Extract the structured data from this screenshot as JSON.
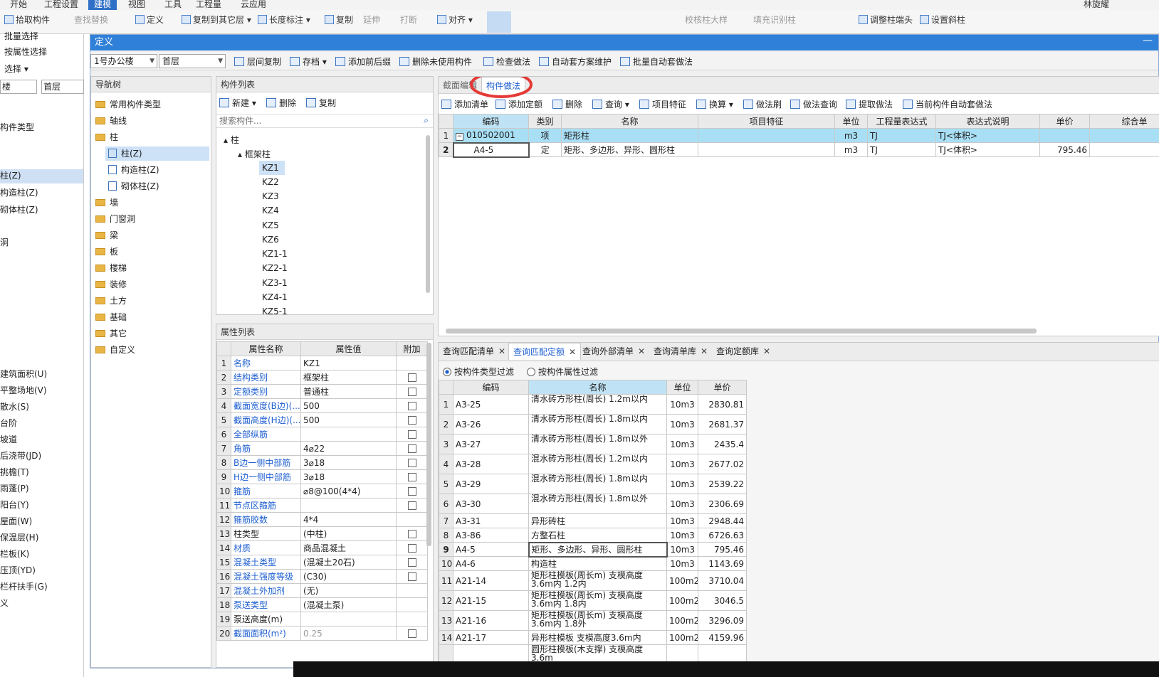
{
  "menubar": {
    "items": [
      "开始",
      "工程设置",
      "建模",
      "视图",
      "工具",
      "工程量",
      "云应用"
    ],
    "active": 2,
    "user": "林旋耀"
  },
  "ribbon": {
    "group1": [
      "拾取构件",
      "批量选择",
      "按属性选择",
      "选择"
    ],
    "items": [
      {
        "label": "查找替换",
        "disabled": true
      },
      {
        "label": "定义",
        "disabled": false
      },
      {
        "label": "复制到其它层",
        "disabled": false
      },
      {
        "label": "长度标注",
        "disabled": false
      },
      {
        "label": "复制",
        "disabled": false
      },
      {
        "label": "延伸",
        "disabled": true
      },
      {
        "label": "打断",
        "disabled": true
      },
      {
        "label": "对齐",
        "disabled": false
      },
      {
        "label": "校核柱大样",
        "disabled": true
      },
      {
        "label": "填充识别柱",
        "disabled": true
      },
      {
        "label": "调整柱端头",
        "disabled": false
      },
      {
        "label": "设置斜柱",
        "disabled": false
      }
    ]
  },
  "left_back": {
    "floor_combo_a": "楼",
    "floor_combo_b": "首层",
    "items": [
      "构件类型",
      "柱(Z)",
      "构造柱(Z)",
      "砌体柱(Z)",
      "洞",
      "建筑面积(U)",
      "平整场地(V)",
      "散水(S)",
      "台阶",
      "坡道",
      "后浇带(JD)",
      "挑檐(T)",
      "雨蓬(P)",
      "阳台(Y)",
      "屋面(W)",
      "保温层(H)",
      "栏板(K)",
      "压顶(YD)",
      "栏杆扶手(G)",
      "义"
    ],
    "selected": 1
  },
  "dialog": {
    "title": "定义",
    "toolbar": {
      "building": "1号办公楼",
      "floor": "首层",
      "buttons": [
        "层间复制",
        "存档",
        "添加前后缀",
        "删除未使用构件",
        "检查做法",
        "自动套方案维护",
        "批量自动套做法"
      ]
    },
    "nav": {
      "header": "导航树",
      "items": [
        "常用构件类型",
        "轴线",
        "柱",
        "柱(Z)",
        "构造柱(Z)",
        "砌体柱(Z)",
        "墙",
        "门窗洞",
        "梁",
        "板",
        "楼梯",
        "装修",
        "土方",
        "基础",
        "其它",
        "自定义"
      ]
    },
    "component_list": {
      "header": "构件列表",
      "buttons": [
        "新建",
        "删除",
        "复制"
      ],
      "search_placeholder": "搜索构件...",
      "tree_root": "柱",
      "tree_group": "框架柱",
      "items": [
        "KZ1",
        "KZ2",
        "KZ3",
        "KZ4",
        "KZ5",
        "KZ6",
        "KZ1-1",
        "KZ2-1",
        "KZ3-1",
        "KZ4-1",
        "KZ5-1"
      ],
      "selected": "KZ1"
    },
    "properties": {
      "header": "属性列表",
      "columns": [
        "属性名称",
        "属性值",
        "附加"
      ],
      "rows": [
        {
          "n": "1",
          "name": "名称",
          "value": "KZ1",
          "blue": true,
          "cb": false
        },
        {
          "n": "2",
          "name": "结构类别",
          "value": "框架柱",
          "blue": true,
          "cb": true
        },
        {
          "n": "3",
          "name": "定额类别",
          "value": "普通柱",
          "blue": true,
          "cb": true
        },
        {
          "n": "4",
          "name": "截面宽度(B边)(...",
          "value": "500",
          "blue": true,
          "cb": true
        },
        {
          "n": "5",
          "name": "截面高度(H边)(...",
          "value": "500",
          "blue": true,
          "cb": true
        },
        {
          "n": "6",
          "name": "全部纵筋",
          "value": "",
          "blue": true,
          "cb": true
        },
        {
          "n": "7",
          "name": "角筋",
          "value": "4⌀22",
          "blue": true,
          "cb": true
        },
        {
          "n": "8",
          "name": "B边一侧中部筋",
          "value": "3⌀18",
          "blue": true,
          "cb": true
        },
        {
          "n": "9",
          "name": "H边一侧中部筋",
          "value": "3⌀18",
          "blue": true,
          "cb": true
        },
        {
          "n": "10",
          "name": "箍筋",
          "value": "⌀8@100(4*4)",
          "blue": true,
          "cb": true
        },
        {
          "n": "11",
          "name": "节点区箍筋",
          "value": "",
          "blue": true,
          "cb": true
        },
        {
          "n": "12",
          "name": "箍筋胶数",
          "value": "4*4",
          "blue": true,
          "cb": false
        },
        {
          "n": "13",
          "name": "柱类型",
          "value": "(中柱)",
          "blue": false,
          "cb": true
        },
        {
          "n": "14",
          "name": "材质",
          "value": "商品混凝土",
          "blue": true,
          "cb": true
        },
        {
          "n": "15",
          "name": "混凝土类型",
          "value": "(混凝土20石)",
          "blue": true,
          "cb": true
        },
        {
          "n": "16",
          "name": "混凝土强度等级",
          "value": "(C30)",
          "blue": true,
          "cb": true
        },
        {
          "n": "17",
          "name": "混凝土外加剂",
          "value": "(无)",
          "blue": true,
          "cb": false
        },
        {
          "n": "18",
          "name": "泵送类型",
          "value": "(混凝土泵)",
          "blue": true,
          "cb": false
        },
        {
          "n": "19",
          "name": "泵送高度(m)",
          "value": "",
          "blue": false,
          "cb": false
        },
        {
          "n": "20",
          "name": "截面面积(m²)",
          "value": "0.25",
          "blue": true,
          "cb": true,
          "gray": true
        }
      ]
    },
    "method": {
      "tabs": [
        "截面编辑",
        "构件做法"
      ],
      "active_tab": 1,
      "toolbar": [
        "添加清单",
        "添加定额",
        "删除",
        "查询",
        "项目特征",
        "换算",
        "做法刷",
        "做法查询",
        "提取做法",
        "当前构件自动套做法"
      ],
      "columns": [
        "编码",
        "类别",
        "名称",
        "项目特征",
        "单位",
        "工程量表达式",
        "表达式说明",
        "单价",
        "综合单"
      ],
      "rows": [
        {
          "n": "1",
          "code": "010502001",
          "type": "项",
          "name": "矩形柱",
          "feature": "",
          "unit": "m3",
          "expr": "TJ",
          "desc": "TJ<体积>",
          "price": ""
        },
        {
          "n": "2",
          "code": "A4-5",
          "type": "定",
          "name": "矩形、多边形、异形、圆形柱",
          "feature": "",
          "unit": "m3",
          "expr": "TJ",
          "desc": "TJ<体积>",
          "price": "795.46"
        }
      ]
    },
    "query": {
      "tabs": [
        "查询匹配清单",
        "查询匹配定额",
        "查询外部清单",
        "查询清单库",
        "查询定额库"
      ],
      "active_tab": 1,
      "filters": [
        "按构件类型过滤",
        "按构件属性过滤"
      ],
      "active_filter": 0,
      "columns": [
        "编码",
        "名称",
        "单位",
        "单价"
      ],
      "rows": [
        {
          "n": "1",
          "code": "A3-25",
          "name": "清水砖方形柱(周长) 1.2m以内",
          "unit": "10m3",
          "price": "2830.81"
        },
        {
          "n": "2",
          "code": "A3-26",
          "name": "清水砖方形柱(周长) 1.8m以内",
          "unit": "10m3",
          "price": "2681.37"
        },
        {
          "n": "3",
          "code": "A3-27",
          "name": "清水砖方形柱(周长) 1.8m以外",
          "unit": "10m3",
          "price": "2435.4"
        },
        {
          "n": "4",
          "code": "A3-28",
          "name": "混水砖方形柱(周长) 1.2m以内",
          "unit": "10m3",
          "price": "2677.02"
        },
        {
          "n": "5",
          "code": "A3-29",
          "name": "混水砖方形柱(周长) 1.8m以内",
          "unit": "10m3",
          "price": "2539.22"
        },
        {
          "n": "6",
          "code": "A3-30",
          "name": "混水砖方形柱(周长) 1.8m以外",
          "unit": "10m3",
          "price": "2306.69"
        },
        {
          "n": "7",
          "code": "A3-31",
          "name": "异形砖柱",
          "unit": "10m3",
          "price": "2948.44"
        },
        {
          "n": "8",
          "code": "A3-86",
          "name": "方整石柱",
          "unit": "10m3",
          "price": "6726.63"
        },
        {
          "n": "9",
          "code": "A4-5",
          "name": "矩形、多边形、异形、圆形柱",
          "unit": "10m3",
          "price": "795.46"
        },
        {
          "n": "10",
          "code": "A4-6",
          "name": "构造柱",
          "unit": "10m3",
          "price": "1143.69"
        },
        {
          "n": "11",
          "code": "A21-14",
          "name": "矩形柱模板(周长m) 支模高度3.6m内 1.2内",
          "unit": "100m2",
          "price": "3710.04"
        },
        {
          "n": "12",
          "code": "A21-15",
          "name": "矩形柱模板(周长m) 支模高度3.6m内 1.8内",
          "unit": "100m2",
          "price": "3046.5"
        },
        {
          "n": "13",
          "code": "A21-16",
          "name": "矩形柱模板(周长m) 支模高度3.6m内 1.8外",
          "unit": "100m2",
          "price": "3296.09"
        },
        {
          "n": "14",
          "code": "A21-17",
          "name": "异形柱模板 支模高度3.6m内",
          "unit": "100m2",
          "price": "4159.96"
        },
        {
          "n": "",
          "code": "",
          "name": "圆形柱模板(木支撑) 支模高度3.6m",
          "unit": "",
          "price": ""
        }
      ]
    }
  },
  "colors": {
    "accent": "#1e5fd0",
    "title_bar": "#2f80d8",
    "highlight": "#e53935",
    "selected_row": "#a8dff5"
  }
}
